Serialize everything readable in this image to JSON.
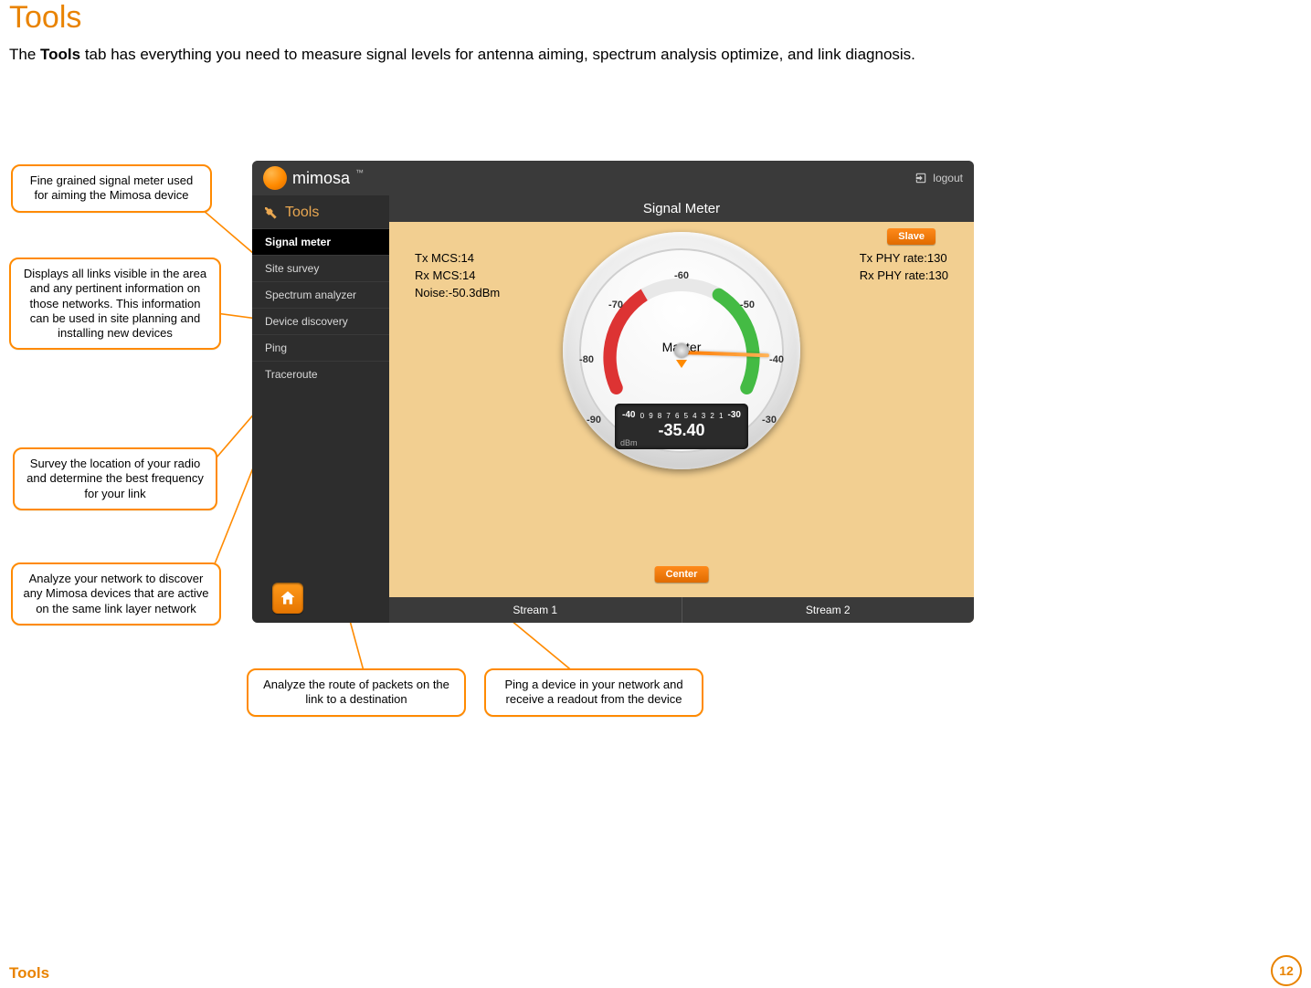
{
  "page": {
    "title": "Tools",
    "intro_prefix": "The ",
    "intro_bold": "Tools",
    "intro_suffix": " tab has everything you need to measure signal levels for antenna aiming, spectrum analysis optimize, and link diagnosis.",
    "footer": "Tools",
    "page_number": "12"
  },
  "app": {
    "brand": "mimosa",
    "logout": "logout",
    "sidebar_title": "Tools",
    "menu": [
      "Signal meter",
      "Site survey",
      "Spectrum analyzer",
      "Device discovery",
      "Ping",
      "Traceroute"
    ],
    "main_title": "Signal Meter",
    "stats_left": {
      "l1": "Tx MCS:14",
      "l2": "Rx MCS:14",
      "l3": "Noise:-50.3dBm"
    },
    "stats_right": {
      "l1": "Tx PHY rate:130",
      "l2": "Rx PHY rate:130"
    },
    "tags": {
      "slave": "Slave",
      "center": "Center"
    },
    "streams": [
      "Stream 1",
      "Stream 2"
    ],
    "gauge": {
      "label": "Master",
      "ticks": [
        "-90",
        "-80",
        "-70",
        "-60",
        "-50",
        "-40",
        "-30"
      ],
      "scale_left": "-40",
      "scale_right": "-30",
      "scale_mid": [
        "0",
        "9",
        "8",
        "7",
        "6",
        "5",
        "4",
        "3",
        "2",
        "1"
      ],
      "value": "-35.40",
      "unit": "dBm"
    }
  },
  "callouts": {
    "c1": "Fine grained signal meter used for aiming the Mimosa device",
    "c2": "Displays all links visible in the area and any pertinent information on those networks. This information can be used in site planning and installing new devices",
    "c3": "Survey the location of your radio and determine the best frequency for your link",
    "c4": "Analyze your network to discover any Mimosa devices that are active on the same link layer network",
    "c5": "Analyze the route of packets on the link to a destination",
    "c6": "Ping a device in your network and receive a readout from the device"
  },
  "chart_data": {
    "type": "gauge",
    "title": "Signal Meter",
    "label": "Master",
    "value": -35.4,
    "unit": "dBm",
    "range": [
      -90,
      -30
    ],
    "ticks": [
      -90,
      -80,
      -70,
      -60,
      -50,
      -40,
      -30
    ],
    "fine_scale": {
      "from": -40,
      "to": -30,
      "marks": [
        0,
        9,
        8,
        7,
        6,
        5,
        4,
        3,
        2,
        1
      ]
    },
    "left_stats": {
      "Tx MCS": 14,
      "Rx MCS": 14,
      "Noise_dBm": -50.3
    },
    "right_stats": {
      "Tx PHY rate": 130,
      "Rx PHY rate": 130
    },
    "role_tag": "Slave"
  }
}
